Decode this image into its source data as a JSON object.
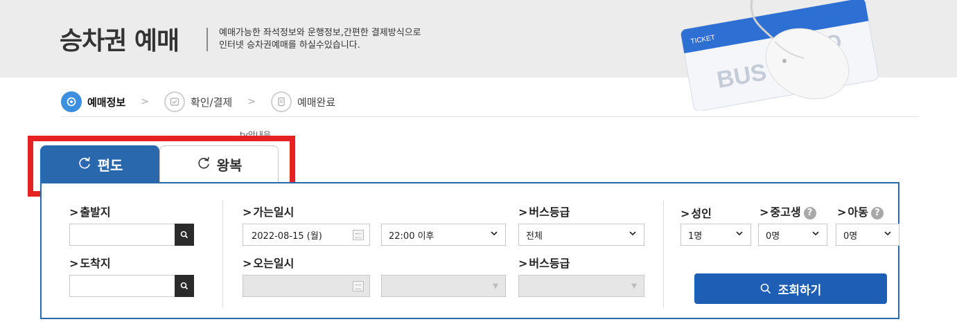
{
  "header": {
    "title": "승차권 예매",
    "subtitle_line1": "예매가능한 좌석정보와 운행정보,간편한 결제방식으로",
    "subtitle_line2": "인터넷 승차권예매를 하실수있습니다.",
    "art_ticket_label": "TICKET",
    "art_brand_left": "BUS",
    "art_brand_right": "AGO"
  },
  "steps": [
    {
      "label": "예매정보",
      "icon": "location-pin-icon",
      "active": true
    },
    {
      "label": "확인/결제",
      "icon": "check-icon",
      "active": false
    },
    {
      "label": "예매완료",
      "icon": "document-icon",
      "active": false
    }
  ],
  "step_separator": ">",
  "tv_note": "tv안내음",
  "tabs": {
    "oneway": "편도",
    "roundtrip": "왕복"
  },
  "form": {
    "departure_label": "출발지",
    "arrival_label": "도착지",
    "go_date_label": "가는일시",
    "return_date_label": "오는일시",
    "bus_grade_label": "버스등급",
    "bus_grade_label_2": "버스등급",
    "adult_label": "성인",
    "student_label": "중고생",
    "child_label": "아동",
    "go_date_value": "2022-08-15 (월)",
    "go_time_value": "22:00 이후",
    "bus_grade_value": "전체",
    "adult_value": "1명",
    "student_value": "0명",
    "child_value": "0명",
    "help_mark": "?",
    "query_button": "조회하기"
  },
  "colors": {
    "accent": "#2a68ad",
    "query_button": "#1f5eb5",
    "step_active": "#3d8fe0",
    "highlight": "#e52222"
  }
}
